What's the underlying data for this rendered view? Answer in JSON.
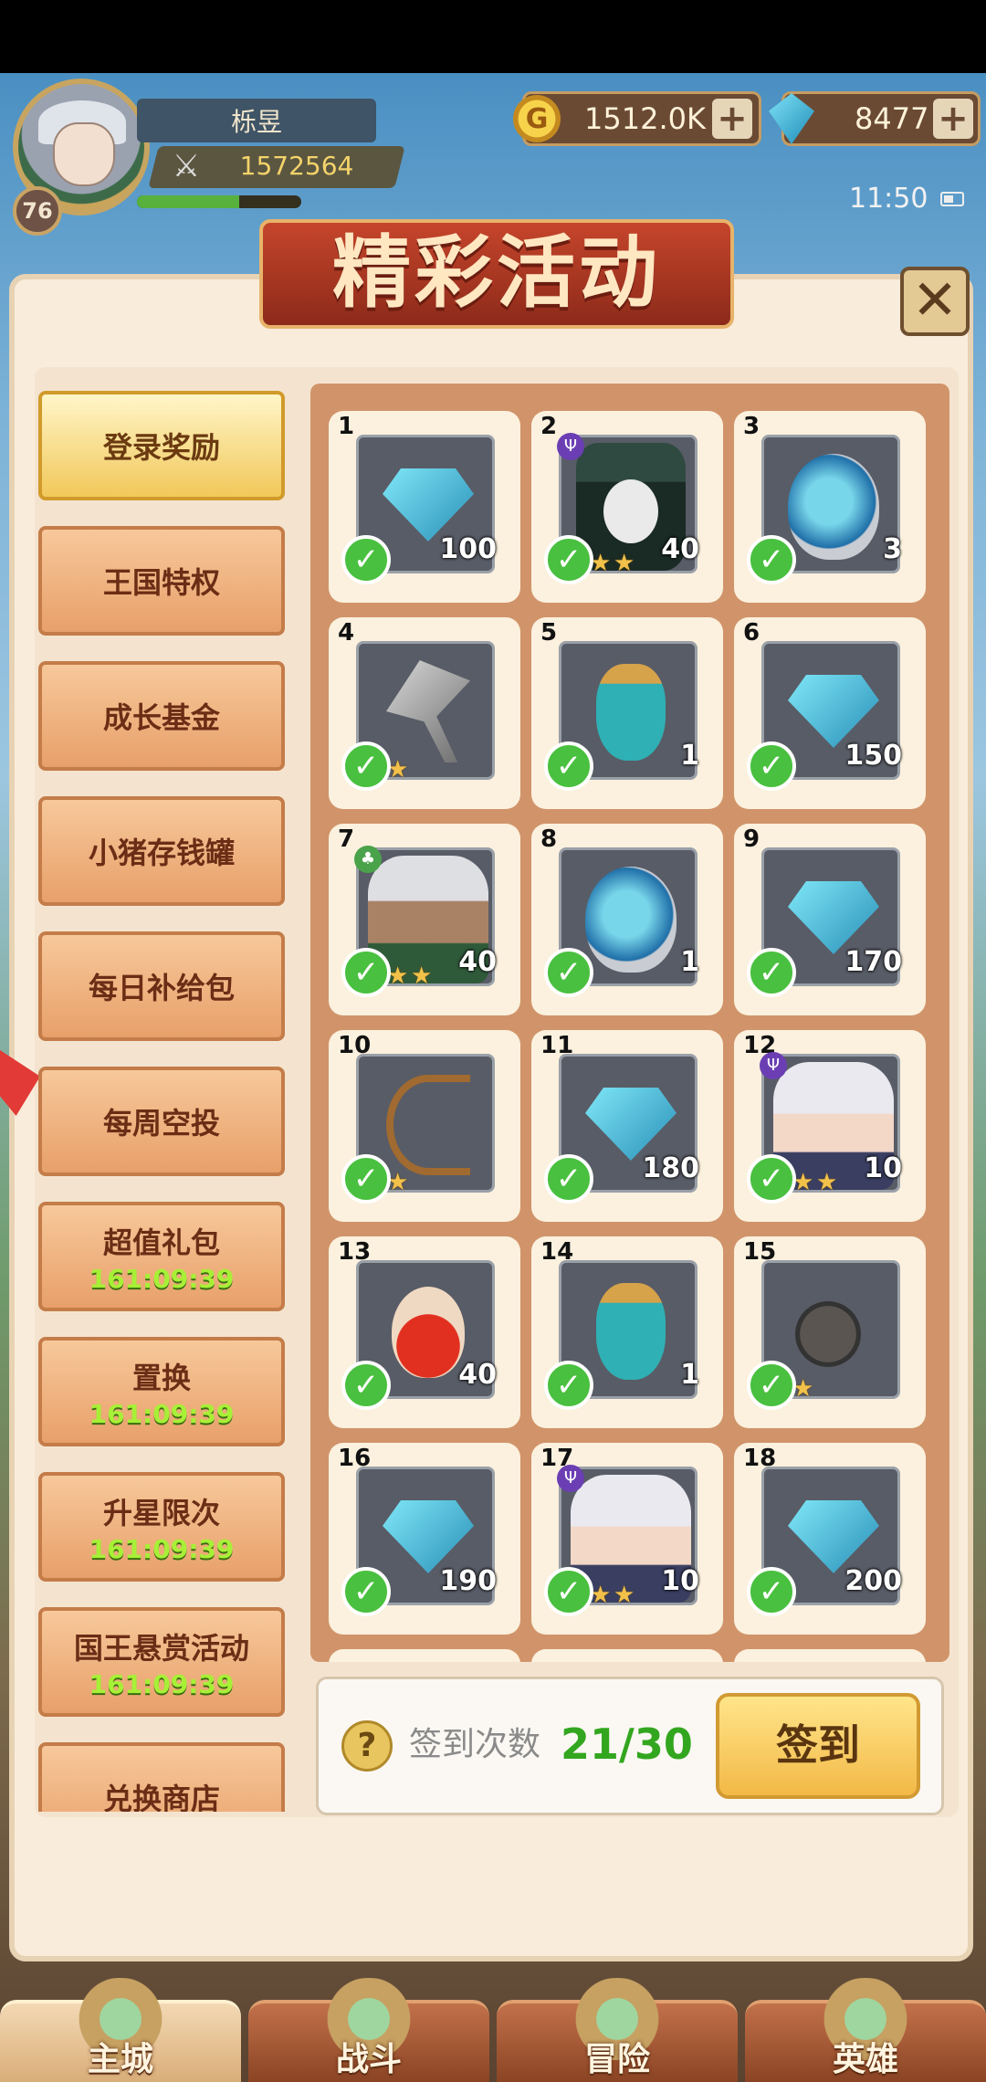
{
  "player": {
    "name": "栎昱",
    "level": "76",
    "power": "1572564",
    "exp_fraction": 0.62
  },
  "currency": {
    "gold": "1512.0K",
    "gems": "8477"
  },
  "clock": "11:50",
  "title": "精彩活动",
  "menu": [
    {
      "label": "登录奖励",
      "timer": "",
      "active": true
    },
    {
      "label": "王国特权",
      "timer": ""
    },
    {
      "label": "成长基金",
      "timer": ""
    },
    {
      "label": "小猪存钱罐",
      "timer": ""
    },
    {
      "label": "每日补给包",
      "timer": ""
    },
    {
      "label": "每周空投",
      "timer": ""
    },
    {
      "label": "超值礼包",
      "timer": "161:09:39"
    },
    {
      "label": "置换",
      "timer": "161:09:39"
    },
    {
      "label": "升星限次",
      "timer": "161:09:39"
    },
    {
      "label": "国王悬赏活动",
      "timer": "161:09:39"
    },
    {
      "label": "兑换商店",
      "timer": ""
    }
  ],
  "rewards": [
    {
      "num": "1",
      "icon": "gem-icon",
      "qty": "100",
      "stars": 0
    },
    {
      "num": "2",
      "icon": "masked-hero-icon",
      "qty": "40",
      "stars": 2
    },
    {
      "num": "3",
      "icon": "egg-icon",
      "qty": "3",
      "stars": 0
    },
    {
      "num": "4",
      "icon": "axe-icon",
      "qty": "",
      "stars": 1
    },
    {
      "num": "5",
      "icon": "flask-icon",
      "qty": "1",
      "stars": 0
    },
    {
      "num": "6",
      "icon": "gem-icon",
      "qty": "150",
      "stars": 0
    },
    {
      "num": "7",
      "icon": "elf-hero-icon",
      "qty": "40",
      "stars": 2
    },
    {
      "num": "8",
      "icon": "egg-icon",
      "qty": "1",
      "stars": 0
    },
    {
      "num": "9",
      "icon": "gem-icon",
      "qty": "170",
      "stars": 0
    },
    {
      "num": "10",
      "icon": "bow-icon",
      "qty": "",
      "stars": 1
    },
    {
      "num": "11",
      "icon": "gem-icon",
      "qty": "180",
      "stars": 0
    },
    {
      "num": "12",
      "icon": "girl-hero-icon",
      "qty": "10",
      "stars": 2
    },
    {
      "num": "13",
      "icon": "potion-icon",
      "qty": "40",
      "stars": 0
    },
    {
      "num": "14",
      "icon": "flask-icon",
      "qty": "1",
      "stars": 0
    },
    {
      "num": "15",
      "icon": "mace-icon",
      "qty": "",
      "stars": 1
    },
    {
      "num": "16",
      "icon": "gem-icon",
      "qty": "190",
      "stars": 0
    },
    {
      "num": "17",
      "icon": "girl-hero-icon",
      "qty": "10",
      "stars": 2
    },
    {
      "num": "18",
      "icon": "gem-icon",
      "qty": "200",
      "stars": 0
    }
  ],
  "signin": {
    "label": "签到次数",
    "count": "21/30",
    "button": "签到"
  },
  "nav": {
    "city": "主城",
    "battle": "战斗",
    "adventure": "冒险",
    "heroes": "英雄"
  }
}
